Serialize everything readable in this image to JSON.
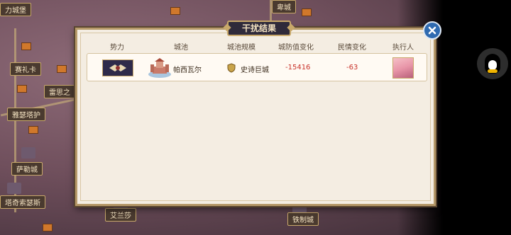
{
  "map": {
    "labels": [
      "力城堡",
      "卑城",
      "赛礼卡",
      "雷思之",
      "雅瑟塔护",
      "萨勒城",
      "塔奇索瑟斯",
      "艾兰莎",
      "铁制城"
    ]
  },
  "dialog": {
    "title": "干扰结果",
    "columns": [
      "势力",
      "城池",
      "城池规模",
      "城防值变化",
      "民情变化",
      "执行人"
    ],
    "rows": [
      {
        "faction_icon": "faction-banner-icon",
        "city_name": "帕西瓦尔",
        "city_scale": "史诗巨城",
        "defense_change": "-15416",
        "morale_change": "-63",
        "executor": "executor-avatar"
      }
    ]
  },
  "colors": {
    "negative": "#c8322a",
    "frame": "#b79a6a",
    "panel": "#f4ede2",
    "close_button": "#2f6ab0"
  },
  "side_buttons": {
    "qq_icon": "qq-penguin-icon"
  }
}
